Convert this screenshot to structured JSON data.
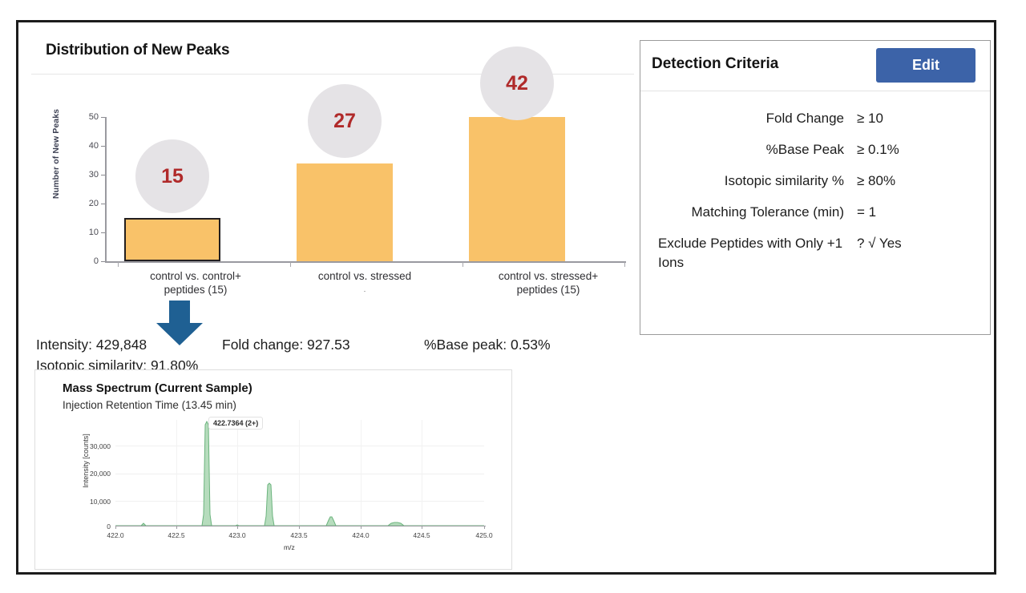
{
  "distribution_card": {
    "title": "Distribution of New Peaks",
    "y_axis_title": "Number of New Peaks"
  },
  "chart_data": {
    "type": "bar",
    "title": "Distribution of New Peaks",
    "xlabel": "",
    "ylabel": "Number of New Peaks",
    "ylim": [
      0,
      50
    ],
    "yticks": [
      0,
      10,
      20,
      30,
      40,
      50
    ],
    "ytick_labels": [
      "0",
      "10",
      "20",
      "30",
      "40",
      "50"
    ],
    "grid": false,
    "legend": "none",
    "categories": [
      "control vs. control+ peptides (15)",
      "control vs. stressed",
      "control vs. stressed+ peptides (15)"
    ],
    "category_lines": [
      [
        "control vs. control+",
        "peptides (15)"
      ],
      [
        "control vs. stressed",
        "."
      ],
      [
        "control vs. stressed+",
        "peptides (15)"
      ]
    ],
    "values": [
      15,
      34,
      50
    ],
    "badge_labels": [
      "15",
      "27",
      "42"
    ],
    "bar_color": "#f9c269",
    "badge_fill": "#e5e3e6",
    "badge_text_color": "#b02a2a",
    "highlighted_index": 0
  },
  "metrics": {
    "intensity": "Intensity: 429,848",
    "fold_change": "Fold change: 927.53",
    "base_peak": "%Base peak: 0.53%",
    "isotopic_similarity": "Isotopic similarity: 91.80%"
  },
  "mass_spectrum": {
    "title": "Mass Spectrum (Current Sample)",
    "subtitle": "Injection Retention Time (13.45 min)",
    "annotation": "422.7364 (2+)",
    "spectrum_chart": {
      "type": "line",
      "title": "Mass Spectrum (Current Sample)",
      "xlabel": "m/z",
      "ylabel": "Intensity [counts]",
      "xlim": [
        422.0,
        425.0
      ],
      "ylim": [
        0,
        37000
      ],
      "xticks": [
        422.0,
        422.5,
        423.0,
        423.5,
        424.0,
        424.5,
        425.0
      ],
      "xtick_labels": [
        "422.0",
        "422.5",
        "423.0",
        "423.5",
        "424.0",
        "424.5",
        "425.0"
      ],
      "yticks": [
        0,
        10000,
        20000,
        30000
      ],
      "ytick_labels": [
        "0",
        "10,000",
        "20,000",
        "30,000"
      ],
      "peaks": [
        {
          "mz": 422.23,
          "intensity": 900
        },
        {
          "mz": 422.735,
          "intensity": 36500
        },
        {
          "mz": 423.0,
          "intensity": 500
        },
        {
          "mz": 423.24,
          "intensity": 14200
        },
        {
          "mz": 423.74,
          "intensity": 3100
        },
        {
          "mz": 424.24,
          "intensity": 900
        }
      ],
      "trace_color": "#6cb47e",
      "fill_color": "#b6dcbd"
    }
  },
  "detection_criteria": {
    "title": "Detection Criteria",
    "edit_label": "Edit",
    "rows": [
      {
        "label": "Fold Change",
        "value": "≥ 10"
      },
      {
        "label": "%Base Peak",
        "value": "≥ 0.1%"
      },
      {
        "label": "Isotopic similarity %",
        "value": "≥ 80%"
      },
      {
        "label": "Matching Tolerance (min)",
        "value": "= 1"
      },
      {
        "label": "Exclude Peptides with Only +1 Ions",
        "value": "? √ Yes"
      }
    ]
  },
  "colors": {
    "accent_blue": "#3c63a8",
    "bar_orange": "#f9c269",
    "badge_gray": "#e5e3e6",
    "badge_red": "#b02a2a",
    "spectrum_green": "#6cb47e",
    "frame_black": "#1c1c1c"
  }
}
